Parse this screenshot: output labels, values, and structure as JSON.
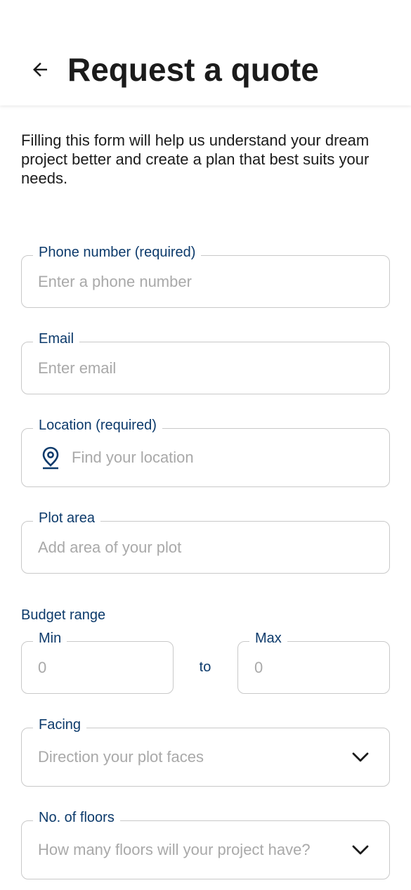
{
  "header": {
    "title": "Request a quote",
    "back_icon": "arrow-left-icon"
  },
  "intro": "Filling this form will help us understand your dream project better and create a plan that best suits your needs.",
  "form": {
    "phone": {
      "label": "Phone number (required)",
      "placeholder": "Enter a phone number"
    },
    "email": {
      "label": "Email",
      "placeholder": "Enter email"
    },
    "location": {
      "label": "Location (required)",
      "placeholder": "Find your location",
      "icon": "location-pin-icon"
    },
    "plot_area": {
      "label": "Plot area",
      "placeholder": "Add area of your plot"
    },
    "budget": {
      "label": "Budget range",
      "min": {
        "label": "Min",
        "placeholder": "0"
      },
      "separator": "to",
      "max": {
        "label": "Max",
        "placeholder": "0"
      }
    },
    "facing": {
      "label": "Facing",
      "placeholder": "Direction your plot faces",
      "icon": "chevron-down-icon"
    },
    "floors": {
      "label": "No. of floors",
      "placeholder": "How many floors will your project have?",
      "icon": "chevron-down-icon"
    }
  },
  "colors": {
    "accent": "#0c3a6b",
    "border": "#c9c9c9",
    "placeholder": "#a9a9a9",
    "text": "#1b1b1b"
  }
}
